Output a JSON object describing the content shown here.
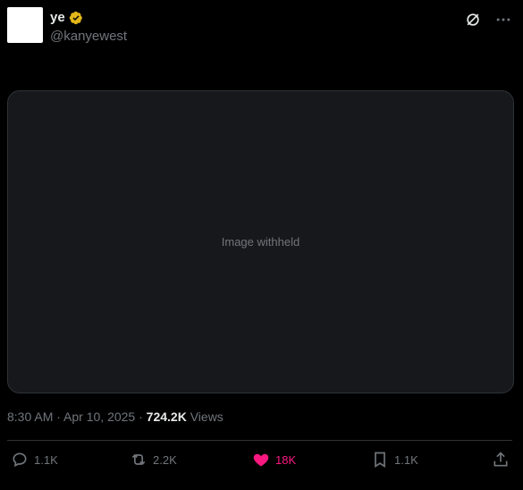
{
  "author": {
    "display_name": "ye",
    "handle": "@kanyewest",
    "verified": true
  },
  "placeholder": "Image withheld",
  "meta": {
    "time": "8:30 AM",
    "date": "Apr 10, 2025",
    "views_count": "724.2K",
    "views_label": "Views"
  },
  "actions": {
    "replies": "1.1K",
    "reposts": "2.2K",
    "likes": "18K",
    "bookmarks": "1.1K"
  },
  "colors": {
    "background": "#000000",
    "like_accent": "#f91880",
    "verified_gold": "#e2b719"
  }
}
